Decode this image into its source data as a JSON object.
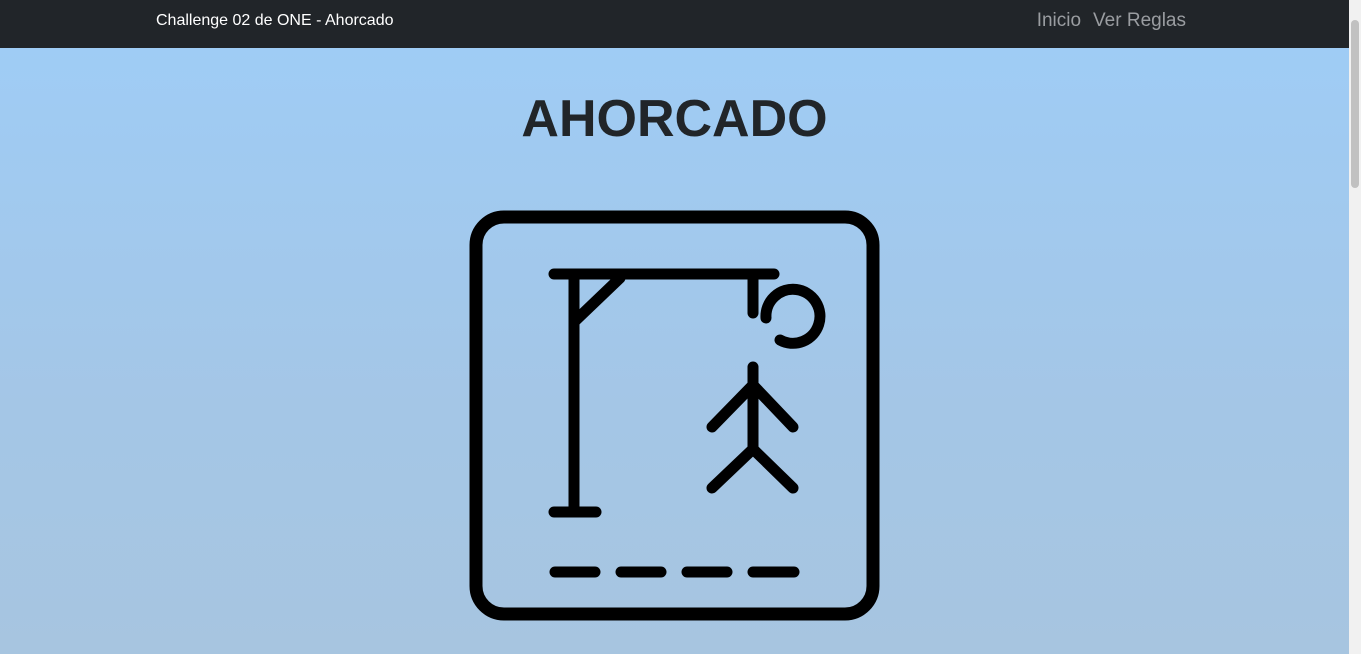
{
  "navbar": {
    "brand": "Challenge 02 de ONE - Ahorcado",
    "links": [
      {
        "label": "Inicio"
      },
      {
        "label": "Ver Reglas"
      }
    ]
  },
  "main": {
    "title": "AHORCADO",
    "image_icon": "hangman-icon"
  },
  "colors": {
    "navbar_bg": "#212529",
    "page_bg_top": "#9fccf5",
    "page_bg_bottom": "#a7c5e0",
    "title_color": "#212529",
    "nav_link_color": "#9a9da1"
  }
}
